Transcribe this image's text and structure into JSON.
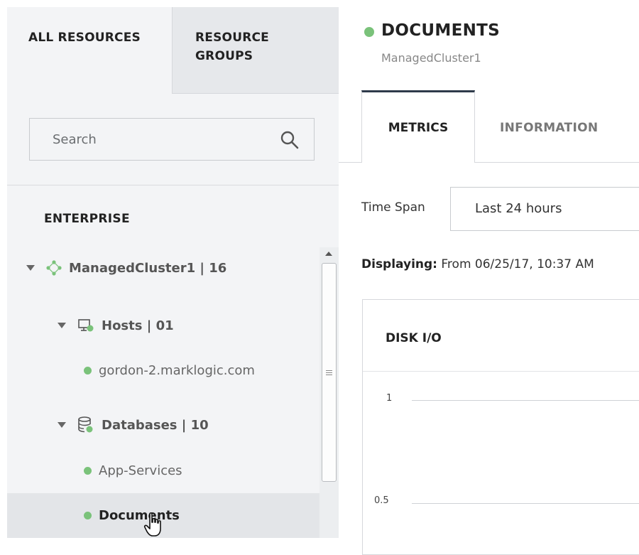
{
  "sidebar": {
    "tabs": [
      {
        "label": "ALL RESOURCES"
      },
      {
        "label": "RESOURCE GROUPS"
      }
    ],
    "search": {
      "placeholder": "Search",
      "value": ""
    },
    "section_title": "ENTERPRISE",
    "tree": {
      "cluster": {
        "label": "ManagedCluster1 | 16",
        "icon": "cluster-icon"
      },
      "hosts": {
        "label": "Hosts | 01",
        "icon": "host-icon"
      },
      "host_items": [
        {
          "label": "gordon-2.marklogic.com",
          "status": "green"
        }
      ],
      "databases": {
        "label": "Databases | 10",
        "icon": "database-icon"
      },
      "database_items": [
        {
          "label": "App-Services",
          "status": "green"
        },
        {
          "label": "Documents",
          "status": "green",
          "selected": true
        }
      ]
    }
  },
  "main": {
    "title": "DOCUMENTS",
    "subtitle": "ManagedCluster1",
    "tabs": [
      {
        "label": "METRICS",
        "active": true
      },
      {
        "label": "INFORMATION",
        "active": false
      }
    ],
    "time_span": {
      "label": "Time Span",
      "value": "Last 24 hours"
    },
    "displaying": {
      "label": "Displaying:",
      "text": "From 06/25/17, 10:37 AM"
    },
    "chart_card": {
      "title": "DISK I/O"
    }
  },
  "chart_data": {
    "type": "line",
    "title": "DISK I/O",
    "ytick_labels": [
      "1",
      "0.5"
    ],
    "yticks": [
      1,
      0.5
    ],
    "grid": true,
    "series": []
  },
  "colors": {
    "status_green": "#7ac27a",
    "sidebar_bg": "#f3f4f6",
    "active_tab_border": "#2e3a4a"
  }
}
